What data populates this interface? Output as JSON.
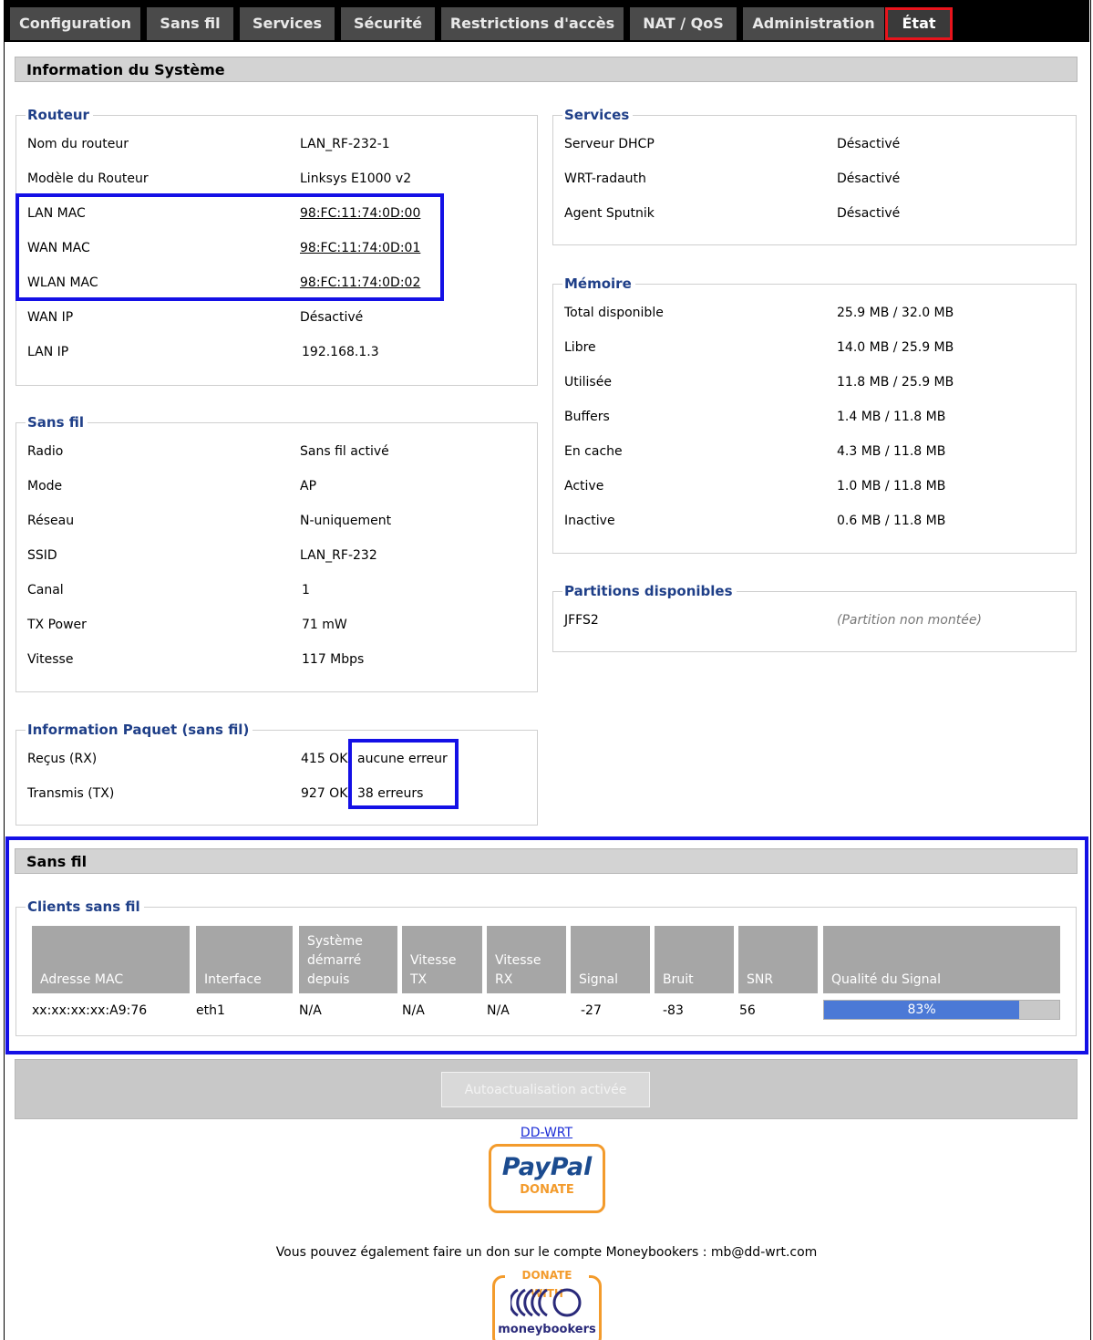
{
  "nav": {
    "tabs": [
      "Configuration",
      "Sans fil",
      "Services",
      "Sécurité",
      "Restrictions d'accès",
      "NAT / QoS",
      "Administration",
      "État"
    ],
    "active": "État"
  },
  "system": {
    "title": "Information du Système",
    "router": {
      "legend": "Routeur",
      "rows": [
        {
          "label": "Nom du routeur",
          "value": "LAN_RF-232-1"
        },
        {
          "label": "Modèle du Routeur",
          "value": "Linksys E1000 v2"
        },
        {
          "label": "LAN MAC",
          "value": "98:FC:11:74:0D:00"
        },
        {
          "label": "WAN MAC",
          "value": "98:FC:11:74:0D:01"
        },
        {
          "label": "WLAN MAC",
          "value": "98:FC:11:74:0D:02"
        },
        {
          "label": "WAN IP",
          "value": "Désactivé"
        },
        {
          "label": "LAN IP",
          "value": "192.168.1.3"
        }
      ]
    },
    "wireless": {
      "legend": "Sans fil",
      "rows": [
        {
          "label": "Radio",
          "value": "Sans fil activé"
        },
        {
          "label": "Mode",
          "value": "AP"
        },
        {
          "label": "Réseau",
          "value": "N-uniquement"
        },
        {
          "label": "SSID",
          "value": "LAN_RF-232"
        },
        {
          "label": "Canal",
          "value": "1"
        },
        {
          "label": "TX Power",
          "value": "71 mW"
        },
        {
          "label": "Vitesse",
          "value": "117 Mbps"
        }
      ]
    },
    "packets": {
      "legend": "Information Paquet (sans fil)",
      "rows": [
        {
          "label": "Reçus (RX)",
          "ok": "415 OK",
          "err": "aucune erreur"
        },
        {
          "label": "Transmis (TX)",
          "ok": "927 OK",
          "err": "38 erreurs"
        }
      ]
    },
    "services": {
      "legend": "Services",
      "rows": [
        {
          "label": "Serveur DHCP",
          "value": "Désactivé"
        },
        {
          "label": "WRT-radauth",
          "value": "Désactivé"
        },
        {
          "label": "Agent Sputnik",
          "value": "Désactivé"
        }
      ]
    },
    "memory": {
      "legend": "Mémoire",
      "rows": [
        {
          "label": "Total disponible",
          "value": "25.9 MB / 32.0 MB"
        },
        {
          "label": "Libre",
          "value": "14.0 MB / 25.9 MB"
        },
        {
          "label": "Utilisée",
          "value": "11.8 MB / 25.9 MB"
        },
        {
          "label": "Buffers",
          "value": "1.4 MB / 11.8 MB"
        },
        {
          "label": "En cache",
          "value": "4.3 MB / 11.8 MB"
        },
        {
          "label": "Active",
          "value": "1.0 MB / 11.8 MB"
        },
        {
          "label": "Inactive",
          "value": "0.6 MB / 11.8 MB"
        }
      ]
    },
    "partitions": {
      "legend": "Partitions disponibles",
      "rows": [
        {
          "label": "JFFS2",
          "value": "(Partition non montée)"
        }
      ]
    }
  },
  "wireless_section": {
    "title": "Sans fil",
    "clients_legend": "Clients sans fil",
    "headers": {
      "mac": "Adresse MAC",
      "iface": "Interface",
      "uptime": [
        "Système",
        "démarré",
        "depuis"
      ],
      "tx": [
        "Vitesse",
        "TX"
      ],
      "rx": [
        "Vitesse",
        "RX"
      ],
      "signal": "Signal",
      "noise": "Bruit",
      "snr": "SNR",
      "quality": "Qualité du Signal"
    },
    "client": {
      "mac": "xx:xx:xx:xx:A9:76",
      "iface": "eth1",
      "uptime": "N/A",
      "tx": "N/A",
      "rx": "N/A",
      "signal": "-27",
      "noise": "-83",
      "snr": "56",
      "quality_label": "83%",
      "quality_fraction": 0.83
    }
  },
  "footer": {
    "autorefresh_button": "Autoactualisation activée",
    "link": "DD-WRT",
    "paypal_top": "PayPal",
    "paypal_bottom": "DONATE",
    "moneybookers_text": "Vous pouvez également faire un don sur le compte Moneybookers : mb@dd-wrt.com",
    "mb_top": "DONATE WITH",
    "mb_bottom": "moneybookers"
  },
  "colors": {
    "legend": "#1f3f88",
    "highlight_blue": "#1410e6",
    "highlight_red": "#e8141c",
    "quality_bar": "#4b79d6"
  }
}
